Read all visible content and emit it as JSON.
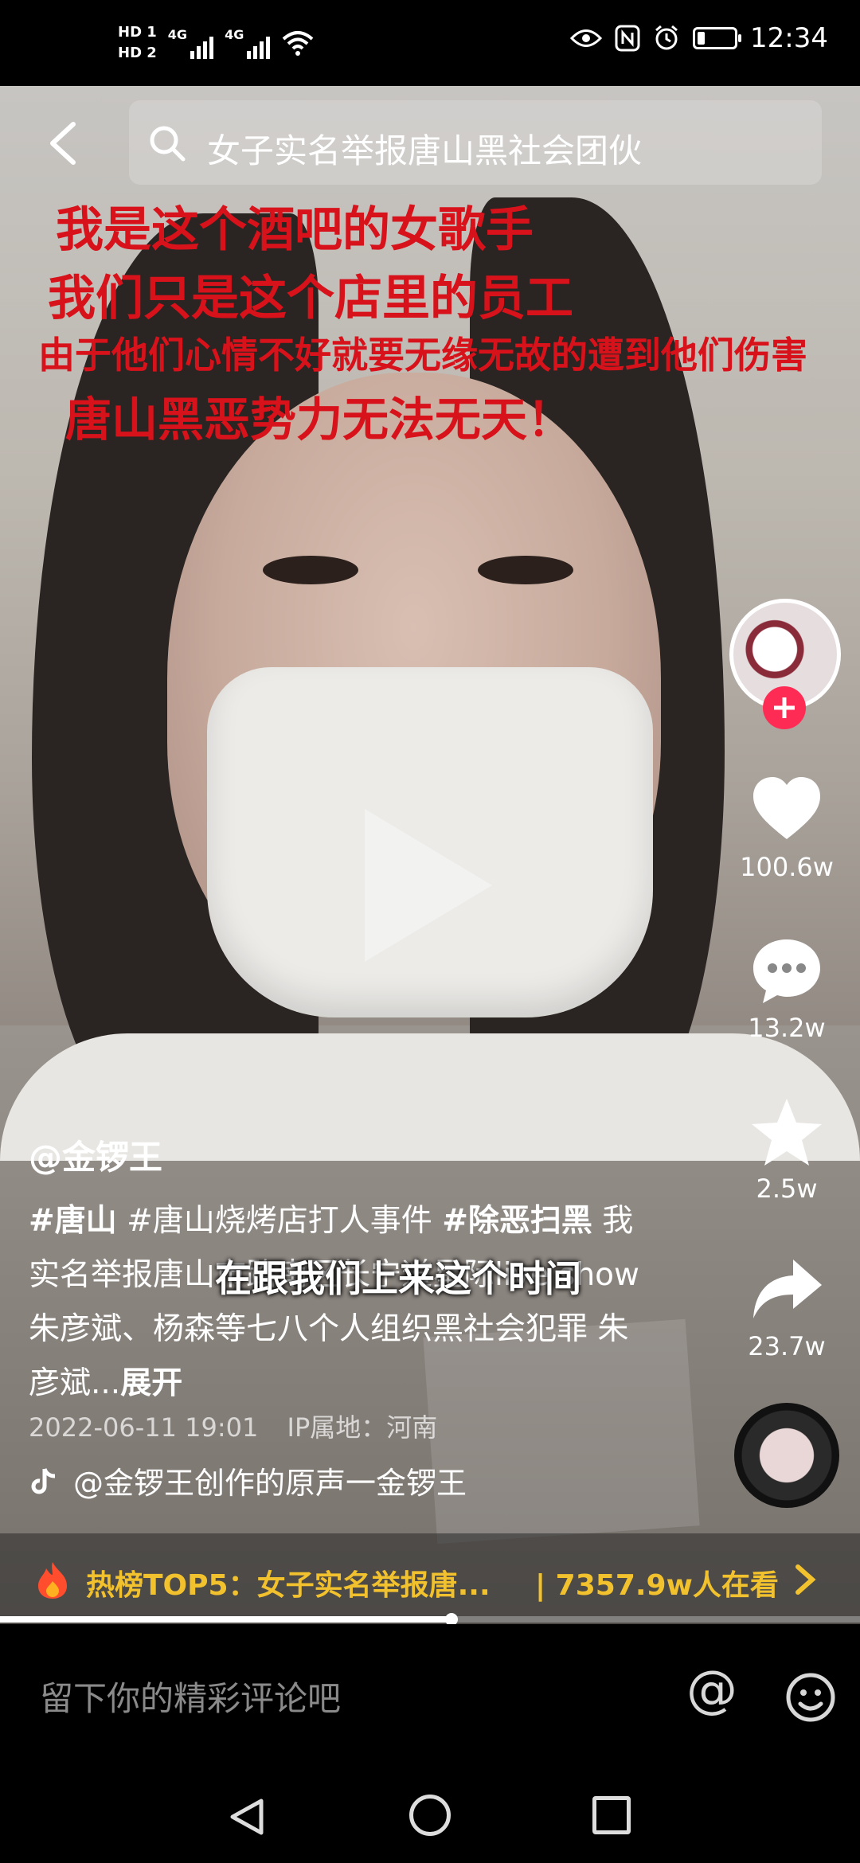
{
  "status_bar": {
    "sim1": "HD 1",
    "sim2": "HD 2",
    "net1": "4G",
    "net2": "4G",
    "time": "12:34",
    "battery_level": 0.3,
    "icons": [
      "wifi-icon",
      "eye-icon",
      "nfc-icon",
      "alarm-icon",
      "battery-icon"
    ]
  },
  "search": {
    "text": "女子实名举报唐山黑社会团伙"
  },
  "video_overlay": {
    "line1": "我是这个酒吧的女歌手",
    "line2": "我们只是这个店里的员工",
    "line3": "由于他们心情不好就要无缘无故的遭到他们伤害",
    "line4": "唐山黑恶势力无法无天！",
    "color": "#d8121b"
  },
  "subtitle": "在跟我们上来这个时间",
  "rail": {
    "likes": "100.6w",
    "comments": "13.2w",
    "favorites": "2.5w",
    "shares": "23.7w"
  },
  "post": {
    "author": "@金锣王",
    "tag1": "#唐山",
    "tag2": "#唐山烧烤店打人事件",
    "tag3": "#除恶扫黑",
    "body": "我实名举报唐山市路南区长宁道星际live show 朱彦斌、杨森等七八个人组织黑社会犯罪 朱彦斌...",
    "expand": "展开",
    "date": "2022-06-11 19:01",
    "ip": "IP属地：河南",
    "music": "@金锣王创作的原声一金锣王"
  },
  "hot": {
    "label": "热榜TOP5：女子实名举报唐...",
    "viewers": "| 7357.9w人在看",
    "color": "#f2c12e"
  },
  "progress": {
    "fraction": 0.525
  },
  "comment": {
    "placeholder": "留下你的精彩评论吧",
    "at": "@"
  }
}
